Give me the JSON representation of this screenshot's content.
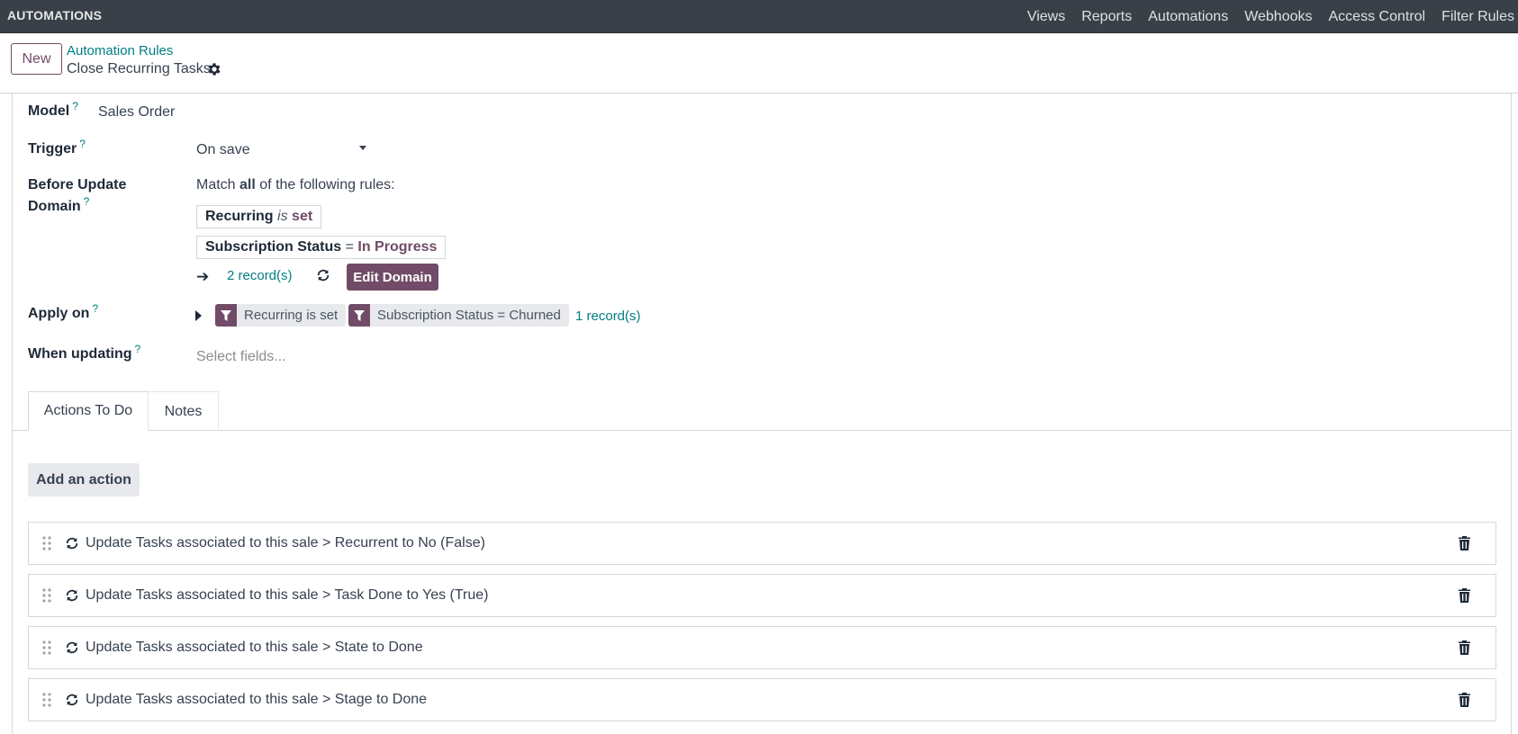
{
  "app": {
    "brand": "AUTOMATIONS"
  },
  "topmenu": [
    "Views",
    "Reports",
    "Automations",
    "Webhooks",
    "Access Control",
    "Filter Rules"
  ],
  "control": {
    "new_label": "New",
    "breadcrumb_parent": "Automation Rules",
    "breadcrumb_current": "Close Recurring Tasks",
    "gear_icon": "gear-icon"
  },
  "form": {
    "model": {
      "label": "Model",
      "help": "?",
      "value": "Sales Order"
    },
    "trigger": {
      "label": "Trigger",
      "help": "?",
      "value": "On save"
    },
    "before_update_domain": {
      "label_line1": "Before Update",
      "label_line2": "Domain",
      "help": "?",
      "match_prefix": "Match",
      "match_bold": "all",
      "match_suffix": "of the following rules:",
      "rules": [
        {
          "field": "Recurring",
          "op": "is",
          "value": "set"
        },
        {
          "field": "Subscription Status",
          "op": "=",
          "value": "In Progress"
        }
      ],
      "records": "2 record(s)",
      "edit_button": "Edit Domain"
    },
    "apply_on": {
      "label": "Apply on",
      "help": "?",
      "facets": [
        "Recurring is set",
        "Subscription Status = Churned"
      ],
      "records": "1 record(s)"
    },
    "when_updating": {
      "label": "When updating",
      "help": "?",
      "placeholder": "Select fields..."
    }
  },
  "tabs": [
    "Actions To Do",
    "Notes"
  ],
  "actions": {
    "add_label": "Add an action",
    "items": [
      "Update Tasks associated to this sale > Recurrent to No (False)",
      "Update Tasks associated to this sale > Task Done to Yes (True)",
      "Update Tasks associated to this sale > State to Done",
      "Update Tasks associated to this sale > Stage to Done"
    ]
  },
  "colors": {
    "brand": "#714b67",
    "link": "#017e84",
    "topbar": "#394048"
  }
}
